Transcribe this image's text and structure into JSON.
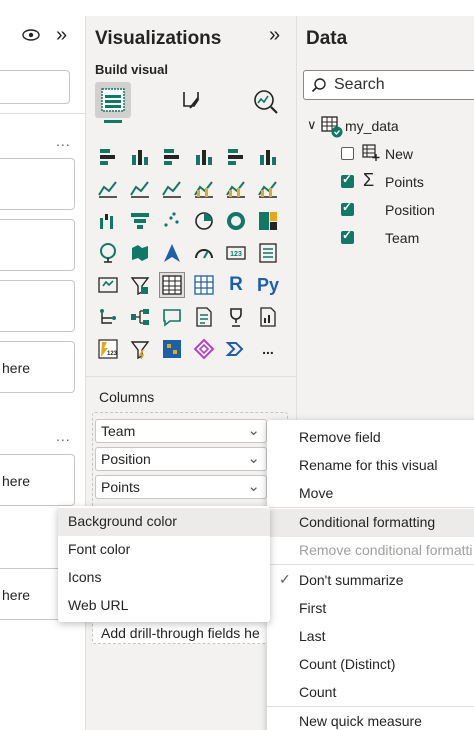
{
  "filters": {
    "here_labels": [
      "here",
      "here",
      "here"
    ],
    "more": "..."
  },
  "viz": {
    "title": "Visualizations",
    "collapse_glyph": "»",
    "build_visual": "Build visual",
    "columns_label": "Columns",
    "fields": [
      "Team",
      "Position",
      "Points"
    ],
    "drill_placeholder": "Add drill-through fields he",
    "grid_more": "..."
  },
  "data_pane": {
    "title": "Data",
    "search_placeholder": "Search",
    "table_name": "my_data",
    "items": [
      {
        "label": "New",
        "checked": false,
        "icon": "new-table-icon"
      },
      {
        "label": "Points",
        "checked": true,
        "icon": "sigma-icon"
      },
      {
        "label": "Position",
        "checked": true,
        "icon": ""
      },
      {
        "label": "Team",
        "checked": true,
        "icon": ""
      }
    ]
  },
  "field_menu": {
    "items": [
      "Remove field",
      "Rename for this visual",
      "Move",
      "Conditional formatting",
      "Remove conditional formatti",
      "Don't summarize",
      "First",
      "Last",
      "Count (Distinct)",
      "Count",
      "New quick measure"
    ],
    "checked_item": "Don't summarize"
  },
  "format_submenu": {
    "items": [
      "Background color",
      "Font color",
      "Icons",
      "Web URL"
    ]
  },
  "colors": {
    "accent": "#117865",
    "pane_bg": "#f3f2f1",
    "menu_hover": "#edebe9"
  }
}
